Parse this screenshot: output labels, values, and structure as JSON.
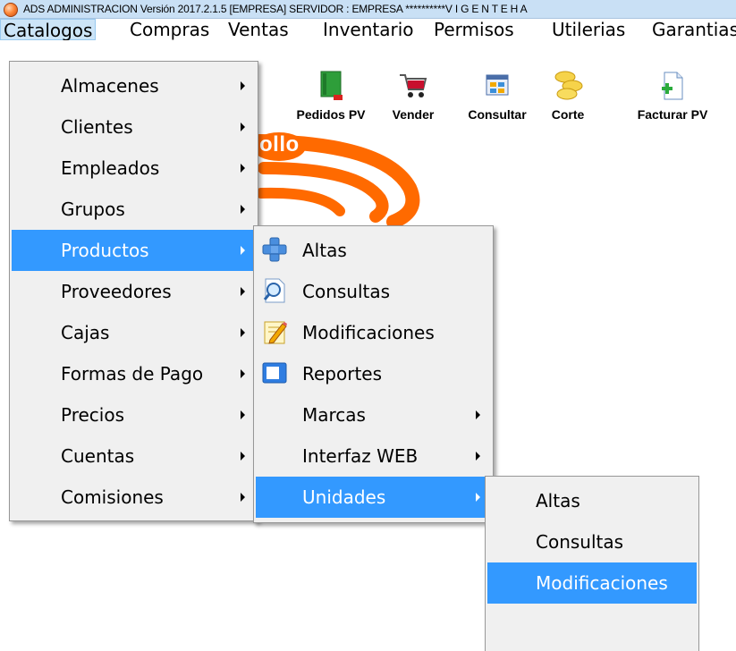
{
  "window": {
    "title": "ADS ADMINISTRACION  Versión 2017.2.1.5    [EMPRESA]     SERVIDOR : EMPRESA   **********V I G E N T E   H A"
  },
  "menubar": {
    "items": [
      {
        "label": "Catalogos"
      },
      {
        "label": "Compras"
      },
      {
        "label": "Ventas"
      },
      {
        "label": "Inventario"
      },
      {
        "label": "Permisos"
      },
      {
        "label": "Utilerias"
      },
      {
        "label": "Garantias"
      }
    ]
  },
  "toolbar": {
    "items": [
      {
        "label": "Pedidos PV",
        "icon": "green-book-icon"
      },
      {
        "label": "Vender",
        "icon": "shopping-cart-icon"
      },
      {
        "label": "Consultar",
        "icon": "calculator-icon"
      },
      {
        "label": "Corte",
        "icon": "coins-icon"
      },
      {
        "label": "Facturar PV",
        "icon": "new-document-icon"
      }
    ]
  },
  "logo": {
    "visible_text": "ollo"
  },
  "catalogos_menu": {
    "items": [
      {
        "label": "Almacenes"
      },
      {
        "label": "Clientes"
      },
      {
        "label": "Empleados"
      },
      {
        "label": "Grupos"
      },
      {
        "label": "Productos"
      },
      {
        "label": "Proveedores"
      },
      {
        "label": "Cajas"
      },
      {
        "label": "Formas de Pago"
      },
      {
        "label": "Precios"
      },
      {
        "label": "Cuentas"
      },
      {
        "label": "Comisiones"
      }
    ]
  },
  "productos_menu": {
    "items": [
      {
        "label": "Altas",
        "icon": "plus-icon"
      },
      {
        "label": "Consultas",
        "icon": "magnifier-icon"
      },
      {
        "label": "Modificaciones",
        "icon": "edit-pencil-icon"
      },
      {
        "label": "Reportes",
        "icon": "report-window-icon"
      },
      {
        "label": "Marcas"
      },
      {
        "label": "Interfaz WEB"
      },
      {
        "label": "Unidades"
      }
    ]
  },
  "unidades_menu": {
    "items": [
      {
        "label": "Altas"
      },
      {
        "label": "Consultas"
      },
      {
        "label": "Modificaciones"
      },
      {
        "label": ""
      }
    ]
  },
  "colors": {
    "highlight": "#3399ff",
    "menu_background": "#f0f0f0",
    "titlebar": "#c9e0f5",
    "logo_orange": "#ff6a00"
  }
}
